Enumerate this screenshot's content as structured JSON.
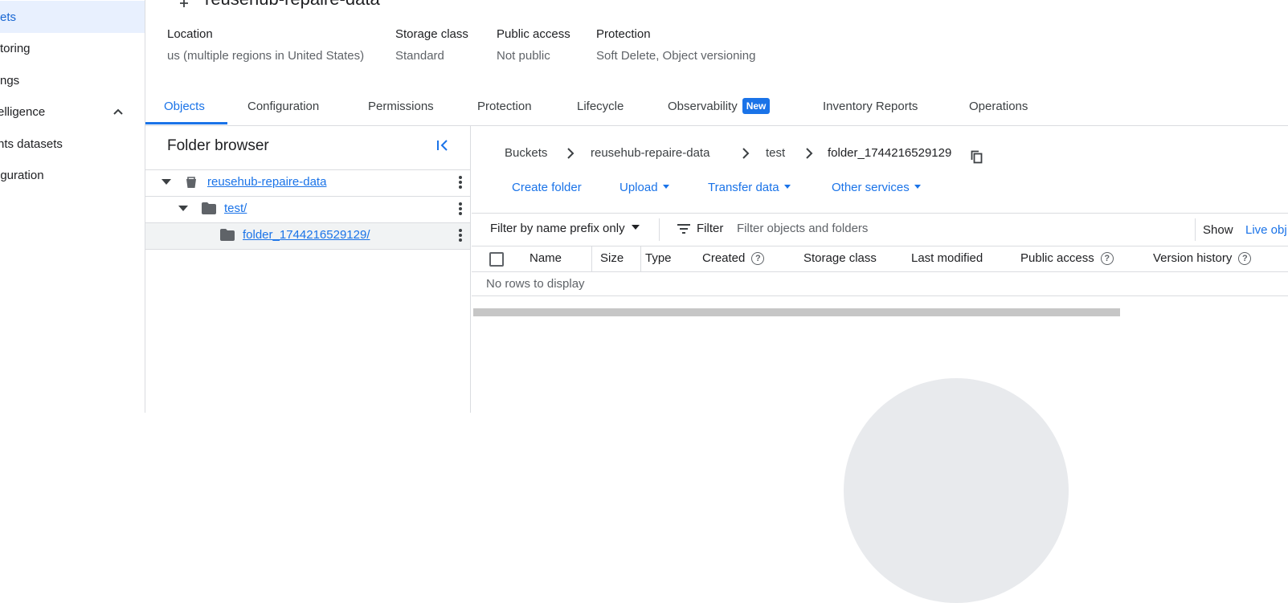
{
  "nav": {
    "items": [
      {
        "label": "ets",
        "active": true
      },
      {
        "label": "toring"
      },
      {
        "label": "ngs"
      },
      {
        "label": "elligence"
      },
      {
        "label": "hts datasets"
      },
      {
        "label": "iguration"
      }
    ]
  },
  "header": {
    "title": "reusehub-repaire-data",
    "meta": [
      {
        "label": "Location",
        "value": "us (multiple regions in United States)"
      },
      {
        "label": "Storage class",
        "value": "Standard"
      },
      {
        "label": "Public access",
        "value": "Not public"
      },
      {
        "label": "Protection",
        "value": "Soft Delete, Object versioning"
      }
    ]
  },
  "tabs": [
    {
      "label": "Objects",
      "active": true
    },
    {
      "label": "Configuration"
    },
    {
      "label": "Permissions"
    },
    {
      "label": "Protection"
    },
    {
      "label": "Lifecycle"
    },
    {
      "label": "Observability",
      "badge": "New"
    },
    {
      "label": "Inventory Reports"
    },
    {
      "label": "Operations"
    }
  ],
  "folder_browser": {
    "title": "Folder browser",
    "tree": [
      {
        "label": "reusehub-repaire-data",
        "type": "bucket"
      },
      {
        "label": "test/",
        "type": "folder"
      },
      {
        "label": "folder_1744216529129/",
        "type": "folder",
        "selected": true
      }
    ]
  },
  "breadcrumbs": [
    "Buckets",
    "reusehub-repaire-data",
    "test",
    "folder_1744216529129"
  ],
  "actions": {
    "create_folder": "Create folder",
    "upload": "Upload",
    "transfer_data": "Transfer data",
    "other_services": "Other services"
  },
  "filter": {
    "mode": "Filter by name prefix only",
    "label": "Filter",
    "placeholder": "Filter objects and folders",
    "show_label": "Show",
    "show_value": "Live obj"
  },
  "table": {
    "columns": [
      "Name",
      "Size",
      "Type",
      "Created",
      "Storage class",
      "Last modified",
      "Public access",
      "Version history"
    ],
    "empty_text": "No rows to display"
  },
  "colors": {
    "accent": "#1a73e8",
    "active_nav_bg": "#e8f0fe"
  }
}
